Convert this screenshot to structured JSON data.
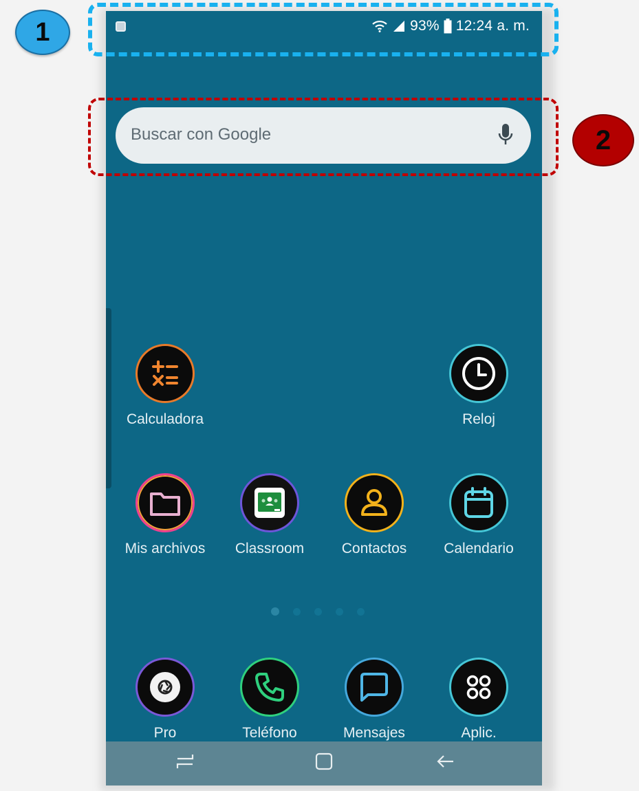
{
  "status_bar": {
    "battery_percent": "93%",
    "time": "12:24 a. m.",
    "icons": [
      "notification-icon",
      "wifi-icon",
      "signal-icon",
      "battery-icon"
    ]
  },
  "search": {
    "placeholder": "Buscar con Google",
    "icon": "mic-icon"
  },
  "apps": {
    "row1": [
      {
        "label": "Calculadora",
        "icon": "calculator-icon",
        "ring": "#e87a2a"
      },
      {
        "label": "Reloj",
        "icon": "clock-icon",
        "ring": "#45c6d6"
      }
    ],
    "row2": [
      {
        "label": "Mis archivos",
        "icon": "folder-icon",
        "ring": "#f0418e"
      },
      {
        "label": "Classroom",
        "icon": "classroom-icon",
        "ring": "#6d56d9"
      },
      {
        "label": "Contactos",
        "icon": "contact-icon",
        "ring": "#f3b21b"
      },
      {
        "label": "Calendario",
        "icon": "calendar-icon",
        "ring": "#45c6d6"
      }
    ]
  },
  "dock": [
    {
      "label": "Pro",
      "icon": "camera-icon",
      "ring": "#7a59d7"
    },
    {
      "label": "Teléfono",
      "icon": "phone-icon",
      "ring": "#2fd07e"
    },
    {
      "label": "Mensajes",
      "icon": "message-icon",
      "ring": "#45a8dc"
    },
    {
      "label": "Aplic.",
      "icon": "apps-grid-icon",
      "ring": "#45c6d6"
    }
  ],
  "navigation": {
    "buttons": [
      "recents-icon",
      "home-icon",
      "back-icon"
    ]
  },
  "annotations": {
    "marker_1": "1",
    "marker_2": "2",
    "colors": {
      "box1": "#19b1ef",
      "box2": "#c00000",
      "marker1": "#2fa7e6",
      "marker2": "#b30000"
    }
  }
}
